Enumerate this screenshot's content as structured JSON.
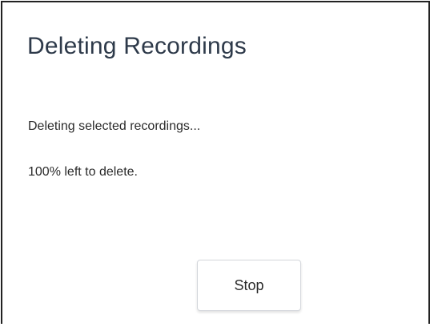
{
  "dialog": {
    "title": "Deleting Recordings",
    "status_message": "Deleting selected recordings...",
    "progress_message": "100% left to delete.",
    "stop_label": "Stop"
  }
}
